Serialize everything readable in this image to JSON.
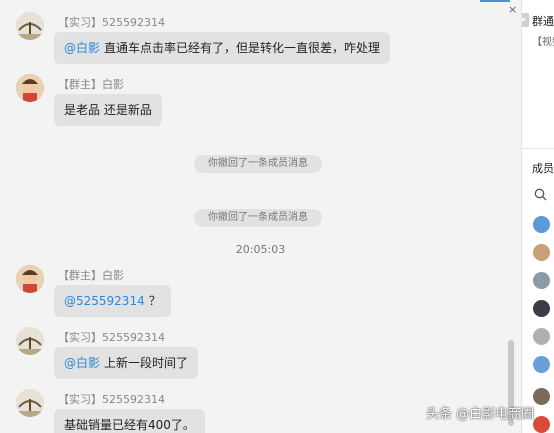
{
  "chat": {
    "messages": [
      {
        "sender": "【实习】525592314",
        "mention": "@白影",
        "text": "直通车点击率已经有了，但是转化一直很差，咋处理"
      },
      {
        "sender": "【群主】白影",
        "mention": "",
        "text": "是老品 还是新品"
      },
      {
        "sender": "【群主】白影",
        "mention": "@525592314",
        "text": "？"
      },
      {
        "sender": "【实习】525592314",
        "mention": "@白影",
        "text": "上新一段时间了"
      },
      {
        "sender": "【实习】525592314",
        "mention": "",
        "text": "基础销量已经有400了。"
      }
    ],
    "system_notices": [
      "你撤回了一条成员消息",
      "你撤回了一条成员消息"
    ],
    "timestamp": "20:05:03",
    "close_glyph": "×"
  },
  "right_panel": {
    "group_title": "群通",
    "notice_snippet": "【视频",
    "members_label": "成员",
    "collapse_glyph": "▸"
  },
  "watermark": "头条 @白影电商圈",
  "colors": {
    "mention": "#2b87d8",
    "bubble": "#e2e2e2",
    "background": "#f3f3f3"
  }
}
